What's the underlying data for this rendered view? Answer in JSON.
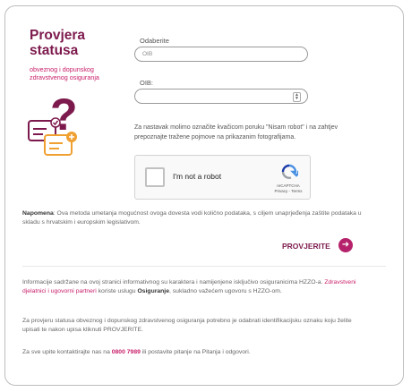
{
  "header": {
    "title_line1": "Provjera",
    "title_line2": "statusa",
    "subtitle_line1": "obveznog i dopunskog",
    "subtitle_line2": "zdravstvenog osiguranja"
  },
  "form": {
    "select_label": "Odaberite",
    "select_value": "OIB",
    "oib_label": "OIB:",
    "oib_value": "",
    "robot_note": "Za nastavak molimo označite kvačicom poruku \"Nisam robot\" i na zahtjev prepoznajte tražene pojmove na prikazanim fotografijama."
  },
  "captcha": {
    "label": "I'm not a robot",
    "brand": "reCAPTCHA",
    "links": "Privacy - Terms"
  },
  "napomena": {
    "head": "Napomena",
    "text": ": Ova metoda umetanja mogućnost ovoga dovesta vodi količno podataka, s ciljem unaprjeđenja zaštite podataka u skladu s hrvatskim i europskim legislativom."
  },
  "submit": {
    "label": "PROVJERITE"
  },
  "info": {
    "p1_a": "Informacije sadržane na ovoj stranici informativnog su karaktera i namijenjene isključivo osiguranicima HZZO-a.",
    "p1_link": "Zdravstveni djelatnici i ugovorni partneri",
    "p1_b": "koriste uslugu",
    "p1_bold": "Osiguranje",
    "p1_c": ", sukladno važećem ugovoru s HZZO-om.",
    "p2": "Za provjeru statusa obveznog i dopunskog zdravstvenog osiguranja potrebno je odabrati identifikacijsku oznaku koju želite upisati te nakon upisa kliknuti PROVJERITE.",
    "p3_a": "Za sve upite kontaktirajte nas na",
    "p3_phone": "0800 7989",
    "p3_b": "ili postavite pitanje na Pitanja i odgovori."
  }
}
